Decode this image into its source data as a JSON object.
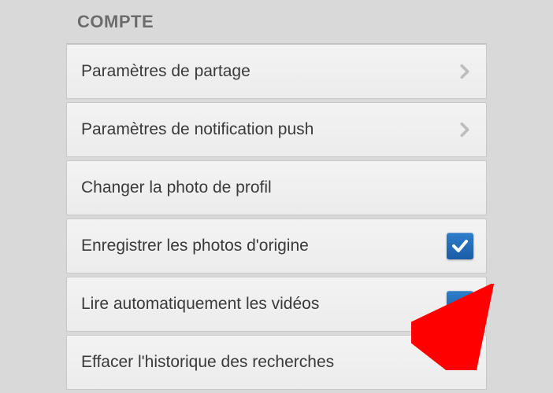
{
  "section_title": "COMPTE",
  "rows": [
    {
      "label": "Paramètres de partage",
      "accessory": "chevron",
      "checked": false
    },
    {
      "label": "Paramètres de notification push",
      "accessory": "chevron",
      "checked": false
    },
    {
      "label": "Changer la photo de profil",
      "accessory": "none",
      "checked": false
    },
    {
      "label": "Enregistrer les photos d'origine",
      "accessory": "checkbox",
      "checked": true
    },
    {
      "label": "Lire automatiquement les vidéos",
      "accessory": "checkbox",
      "checked": true
    },
    {
      "label": "Effacer l'historique des recherches",
      "accessory": "none",
      "checked": false
    }
  ],
  "annotation": {
    "type": "arrow",
    "color": "#ff0000",
    "points_to_row_index": 4
  }
}
